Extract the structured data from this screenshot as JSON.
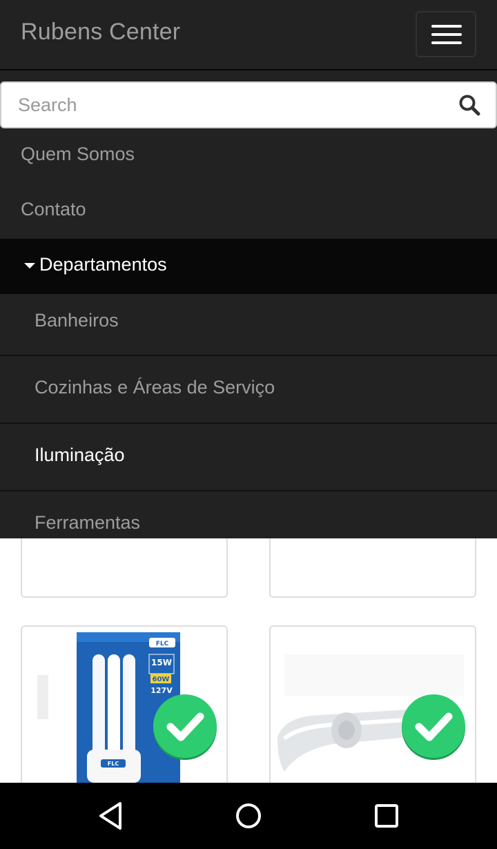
{
  "navbar": {
    "brand": "Rubens Center",
    "menu_toggle": "hamburger-icon"
  },
  "search": {
    "placeholder": "Search",
    "value": "",
    "icon": "search-icon"
  },
  "menu": {
    "links": [
      {
        "label": "Quem Somos"
      },
      {
        "label": "Contato"
      }
    ],
    "departments": {
      "label": "Departamentos",
      "expanded": true,
      "items": [
        {
          "label": "Banheiros",
          "active": false
        },
        {
          "label": "Cozinhas e Áreas de Serviço",
          "active": false
        },
        {
          "label": "Iluminação",
          "active": true
        },
        {
          "label": "Ferramentas",
          "active": false
        }
      ]
    }
  },
  "products": [
    {
      "image": "lamp-package-image",
      "badge": "check-icon"
    },
    {
      "image": "shower-head-image",
      "badge": "check-icon"
    }
  ],
  "colors": {
    "navbar_bg": "#222222",
    "active_bg": "#080808",
    "link_color": "#9d9d9d",
    "check_green": "#2ecc71"
  },
  "system_nav": {
    "back": "back-icon",
    "home": "home-icon",
    "recents": "recents-icon"
  }
}
